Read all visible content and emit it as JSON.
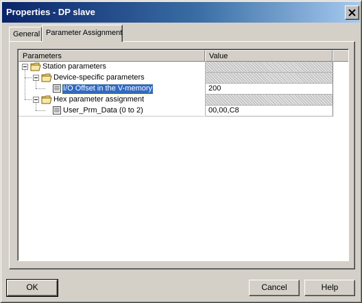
{
  "window": {
    "title": "Properties - DP slave"
  },
  "tabs": [
    {
      "label": "General",
      "active": false
    },
    {
      "label": "Parameter Assignment",
      "active": true
    }
  ],
  "grid": {
    "columns": {
      "parameters": "Parameters",
      "value": "Value"
    },
    "rows": [
      {
        "label": "Station parameters",
        "value": "",
        "icon": "folder-open-icon",
        "expanded": true
      },
      {
        "label": "Device-specific parameters",
        "value": "",
        "icon": "folder-open-icon",
        "expanded": true
      },
      {
        "label": "I/O Offset in the V-memory",
        "value": "200",
        "icon": "parameter-list-icon",
        "selected": true
      },
      {
        "label": "Hex parameter assignment",
        "value": "",
        "icon": "folder-open-icon",
        "expanded": true
      },
      {
        "label": "User_Prm_Data (0 to 2)",
        "value": "00,00,C8",
        "icon": "parameter-list-icon"
      }
    ]
  },
  "buttons": {
    "ok": "OK",
    "cancel": "Cancel",
    "help": "Help"
  },
  "colors": {
    "title_start": "#0a246a",
    "title_end": "#a6caf0",
    "selection": "#316ac5",
    "face": "#d4d0c8"
  }
}
